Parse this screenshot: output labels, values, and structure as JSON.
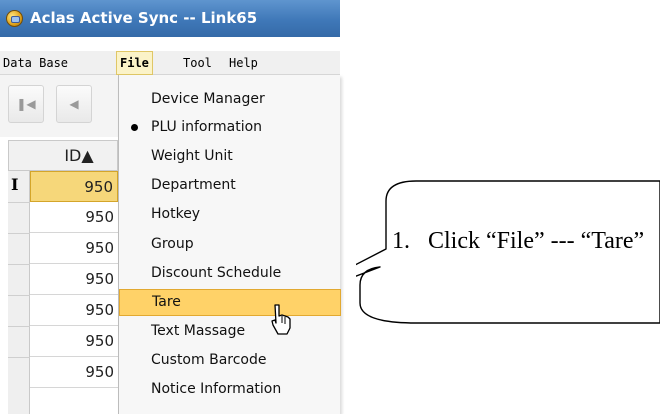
{
  "window": {
    "title": "Aclas Active Sync -- Link65",
    "icon": "app-globe-icon"
  },
  "menubar": {
    "items": [
      "Data Base",
      "File",
      "Tool",
      "Help"
    ],
    "open_item": "File"
  },
  "navigator": {
    "first_icon": "first-record-icon",
    "prev_icon": "prev-record-icon"
  },
  "grid": {
    "column_header": "ID▲",
    "row_indicator": "I",
    "rows": [
      "950",
      "950",
      "950",
      "950",
      "950",
      "950",
      "950"
    ]
  },
  "file_menu": {
    "items": [
      "Device Manager",
      "PLU information",
      "Weight Unit",
      "Department",
      "Hotkey",
      "Group",
      "Discount Schedule",
      "Tare",
      "Text Massage",
      "Custom Barcode",
      "Notice Information"
    ],
    "checked_item": "PLU information",
    "highlighted_item": "Tare"
  },
  "callout": {
    "number": "1.",
    "text": "Click “File” --- “Tare”"
  },
  "colors": {
    "highlight": "#ffd268",
    "selected_row": "#f6d77a",
    "titlebar": "#3f78b8"
  }
}
